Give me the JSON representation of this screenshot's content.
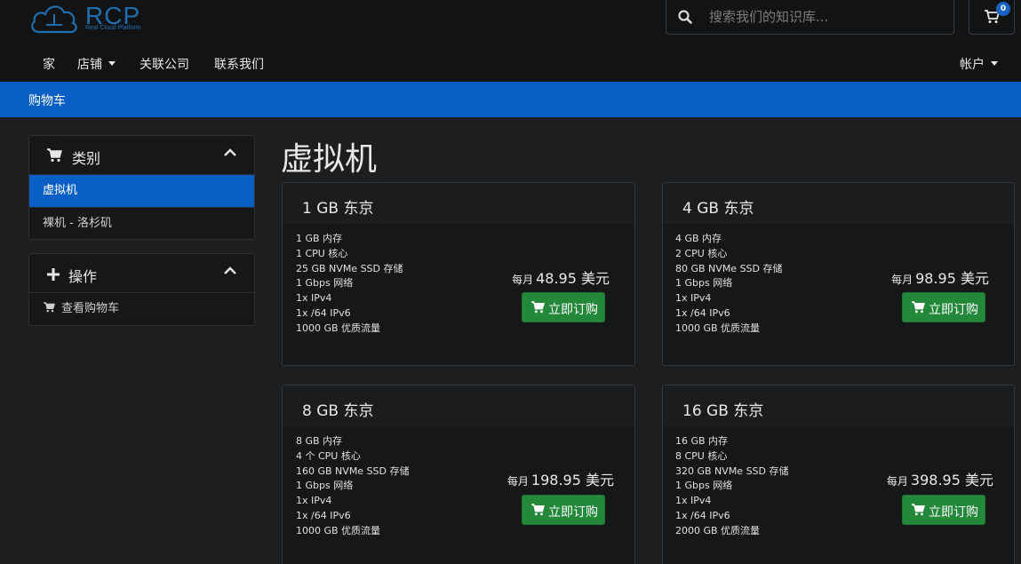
{
  "brand": {
    "name": "RCP",
    "tagline": "Real Cloud Platform",
    "accent": "#1f6fb0"
  },
  "search": {
    "placeholder": "搜索我们的知识库..."
  },
  "cart": {
    "count": "0"
  },
  "nav": {
    "items": [
      {
        "label": "家"
      },
      {
        "label": "店铺"
      },
      {
        "label": "关联公司"
      },
      {
        "label": "联系我们"
      }
    ],
    "account": "帐户"
  },
  "breadcrumb": "购物车",
  "sidebar": {
    "categories": {
      "title": "类别",
      "items": [
        {
          "label": "虚拟机"
        },
        {
          "label": "裸机 - 洛杉矶"
        }
      ]
    },
    "actions": {
      "title": "操作",
      "items": [
        {
          "label": "查看购物车"
        }
      ]
    }
  },
  "page": {
    "title": "虚拟机"
  },
  "products": [
    {
      "title": "1 GB 东京",
      "features": [
        "1 GB 内存",
        "1 CPU 核心",
        "25 GB NVMe SSD 存储",
        "1 Gbps 网络",
        "1x IPv4",
        "1x /64 IPv6",
        "1000 GB 优质流量"
      ],
      "price_prefix": "每月",
      "price": "48.95 美元",
      "button": "立即订购"
    },
    {
      "title": "4 GB 东京",
      "features": [
        "4 GB 内存",
        "2 CPU 核心",
        "80 GB NVMe SSD 存储",
        "1 Gbps 网络",
        "1x IPv4",
        "1x /64 IPv6",
        "1000 GB 优质流量"
      ],
      "price_prefix": "每月",
      "price": "98.95 美元",
      "button": "立即订购"
    },
    {
      "title": "8 GB 东京",
      "features": [
        "8 GB 内存",
        "4 个 CPU 核心",
        "160 GB NVMe SSD 存储",
        "1 Gbps 网络",
        "1x IPv4",
        "1x /64 IPv6",
        "1000 GB 优质流量"
      ],
      "price_prefix": "每月",
      "price": "198.95 美元",
      "button": "立即订购"
    },
    {
      "title": "16 GB 东京",
      "features": [
        "16 GB 内存",
        "8 CPU 核心",
        "320 GB NVMe SSD 存储",
        "1 Gbps 网络",
        "1x IPv4",
        "1x /64 IPv6",
        "2000 GB 优质流量"
      ],
      "price_prefix": "每月",
      "price": "398.95 美元",
      "button": "立即订购"
    }
  ],
  "colors": {
    "primary": "#0a5fc7",
    "success": "#23883a",
    "background": "#1c1e20"
  }
}
